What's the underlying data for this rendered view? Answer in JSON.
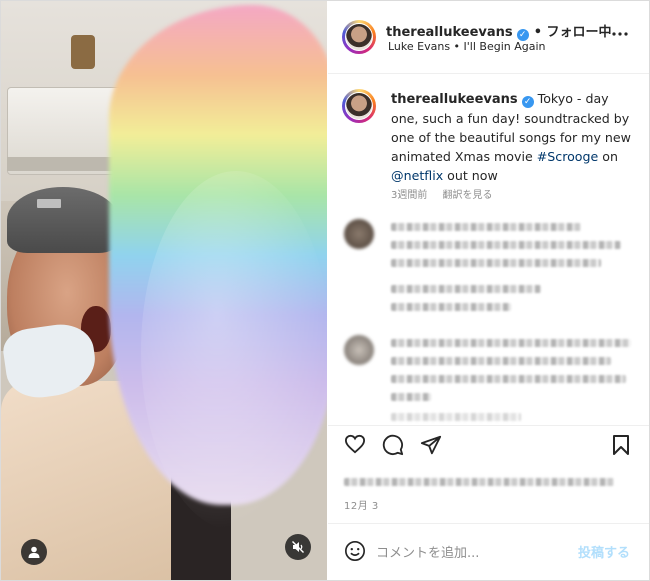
{
  "header": {
    "username": "thereallukeevans",
    "follow_status": "• フォロー中",
    "subtitle": "Luke Evans • I'll Begin Again"
  },
  "caption": {
    "username": "thereallukeevans",
    "text_before_tag": "Tokyo - day one, such a fun day! soundtracked by one of the beautiful songs for my new animated Xmas movie ",
    "hashtag": "#Scrooge",
    "text_mid": " on ",
    "mention": "@netflix",
    "text_after": " out now",
    "time_ago": "3週間前",
    "translate": "翻訳を見る"
  },
  "footer": {
    "date": "12月 3",
    "comment_placeholder": "コメントを追加...",
    "post_button": "投稿する"
  },
  "colors": {
    "link": "#00376b",
    "verified": "#3897f0",
    "post_button_disabled": "#b2dffc"
  },
  "icons": [
    "more-options-icon",
    "verified-icon",
    "heart-icon",
    "comment-icon",
    "share-icon",
    "bookmark-icon",
    "emoji-icon",
    "user-tag-icon",
    "muted-audio-icon"
  ]
}
